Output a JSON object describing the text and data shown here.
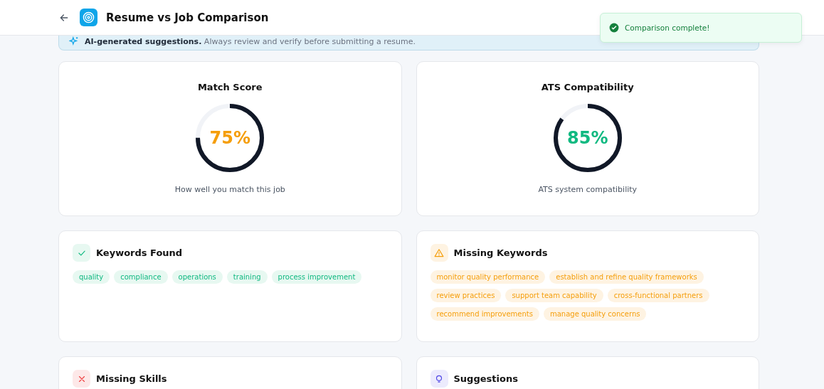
{
  "header": {
    "title": "Resume vs Job Comparison"
  },
  "notice": {
    "text": "**AI-generated suggestions.** Always review and verify before submitting a resume."
  },
  "toast": {
    "text": "Comparison complete!"
  },
  "scores": [
    {
      "title": "Match Score",
      "value": "75%",
      "level": 0.75,
      "color": "#f59e0b",
      "caption": "How well you match this job"
    },
    {
      "title": "ATS Compatibility",
      "value": "85%",
      "level": 0.85,
      "color": "#10b981",
      "caption": "ATS system compatibility"
    }
  ],
  "sections": [
    {
      "kind": "found",
      "title": "Keywords Found",
      "tags": [
        "quality",
        "compliance",
        "operations",
        "training",
        "process improvement"
      ]
    },
    {
      "kind": "missing",
      "title": "Missing Keywords",
      "tags": [
        "monitor quality performance",
        "establish and refine quality frameworks",
        "review practices",
        "support team capability",
        "cross-functional partners",
        "recommend improvements",
        "manage quality concerns"
      ]
    },
    {
      "kind": "skills",
      "title": "Missing Skills"
    },
    {
      "kind": "suggestions",
      "title": "Suggestions"
    }
  ]
}
